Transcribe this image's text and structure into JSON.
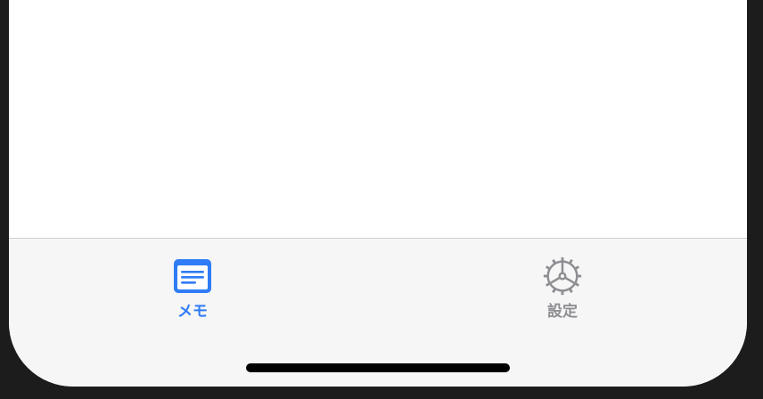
{
  "tab_bar": {
    "tabs": [
      {
        "label": "メモ",
        "icon": "memo-icon",
        "selected": true
      },
      {
        "label": "設定",
        "icon": "gear-icon",
        "selected": false
      }
    ]
  },
  "colors": {
    "accent": "#2f7cf6",
    "inactive": "#8e8e93",
    "tab_bar_background": "#f6f6f6",
    "content_background": "#ffffff",
    "bezel": "#1c1c1c"
  }
}
